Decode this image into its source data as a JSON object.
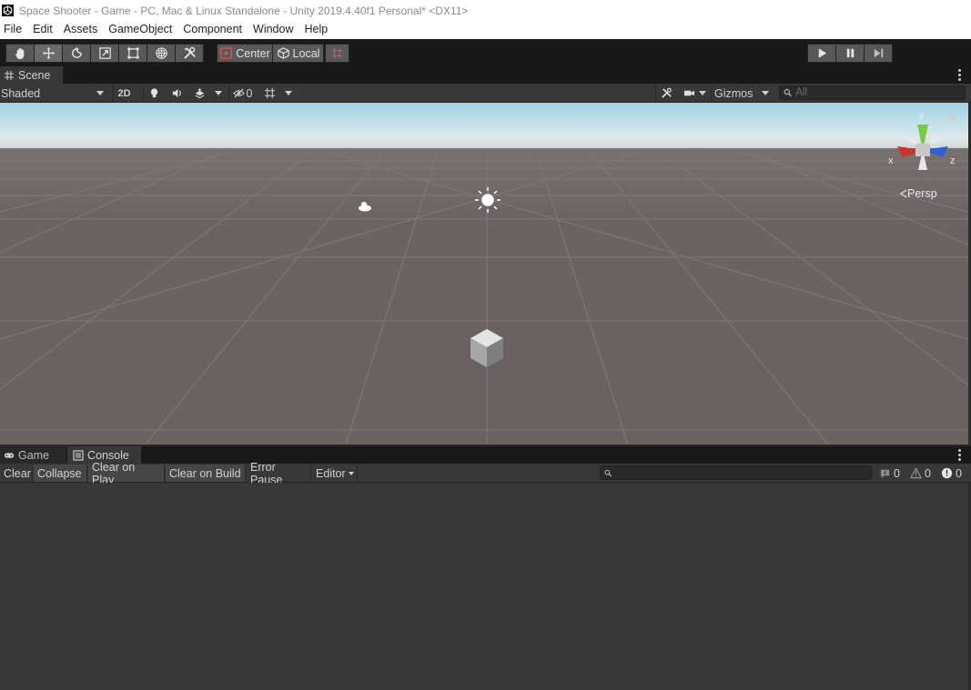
{
  "window": {
    "title": "Space Shooter - Game - PC, Mac & Linux Standalone - Unity 2019.4.40f1 Personal* <DX11>"
  },
  "menu": [
    "File",
    "Edit",
    "Assets",
    "GameObject",
    "Component",
    "Window",
    "Help"
  ],
  "toolbar": {
    "tools": [
      "hand-tool",
      "move-tool",
      "rotate-tool",
      "scale-tool",
      "rect-tool",
      "transform-tool",
      "custom-tool"
    ],
    "active_tool": "move-tool",
    "pivot_label": "Center",
    "space_label": "Local"
  },
  "scene_panel": {
    "tab_label": "Scene",
    "shading_mode": "Shaded",
    "mode_2d": "2D",
    "hidden_count": "0",
    "gizmos_label": "Gizmos",
    "search_placeholder": "All",
    "projection_label": "Persp",
    "axis_labels": {
      "x": "x",
      "y": "y",
      "z": "z"
    }
  },
  "console_panel": {
    "tabs": [
      {
        "label": "Game",
        "icon": "gamepad-icon",
        "active": false
      },
      {
        "label": "Console",
        "icon": "console-icon",
        "active": true
      }
    ],
    "buttons": {
      "clear": "Clear",
      "collapse": "Collapse",
      "clear_on_play": "Clear on Play",
      "clear_on_build": "Clear on Build",
      "error_pause": "Error Pause",
      "editor": "Editor"
    },
    "counts": {
      "info": "0",
      "warning": "0",
      "error": "0"
    },
    "search_placeholder": ""
  },
  "colors": {
    "sky_top": "#9fd3e3",
    "ground": "#6b6361",
    "axis_x": "#d0312d",
    "axis_y": "#7ac943",
    "axis_z": "#2f5fd0"
  }
}
